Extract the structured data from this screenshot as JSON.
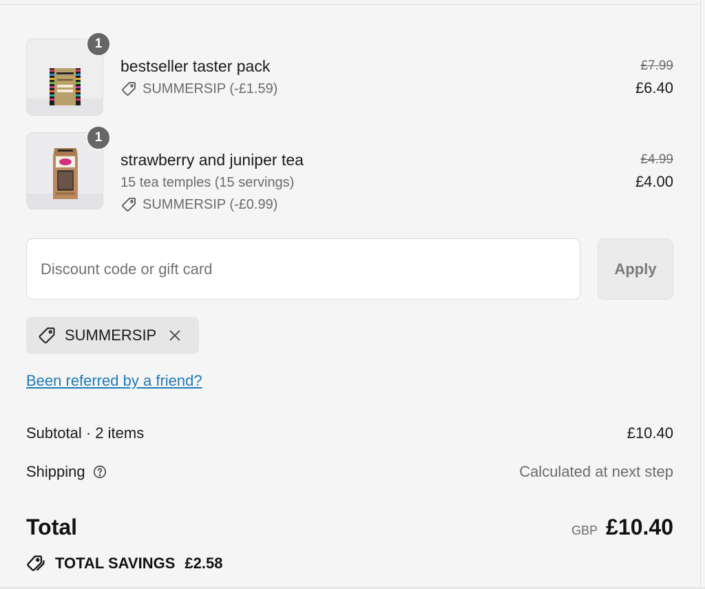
{
  "items": [
    {
      "quantity": "1",
      "title": "bestseller taster pack",
      "variant": "",
      "discount": "SUMMERSIP (-£1.59)",
      "original_price": "£7.99",
      "final_price": "£6.40"
    },
    {
      "quantity": "1",
      "title": "strawberry and juniper tea",
      "variant": "15 tea temples (15 servings)",
      "discount": "SUMMERSIP (-£0.99)",
      "original_price": "£4.99",
      "final_price": "£4.00"
    }
  ],
  "discount": {
    "placeholder": "Discount code or gift card",
    "apply_label": "Apply",
    "applied_code": "SUMMERSIP"
  },
  "referral_link": "Been referred by a friend?",
  "summary": {
    "subtotal_label": "Subtotal · 2 items",
    "subtotal_value": "£10.40",
    "shipping_label": "Shipping",
    "shipping_value": "Calculated at next step",
    "total_label": "Total",
    "currency": "GBP",
    "total_value": "£10.40",
    "savings_label": "TOTAL SAVINGS",
    "savings_value": "£2.58"
  },
  "icons": {
    "tag": "tag-icon",
    "tags": "tags-icon",
    "close": "close-icon",
    "help": "help-circle-icon"
  },
  "colors": {
    "background": "#f5f5f5",
    "link": "#1f7bb6",
    "badge": "#666666"
  }
}
